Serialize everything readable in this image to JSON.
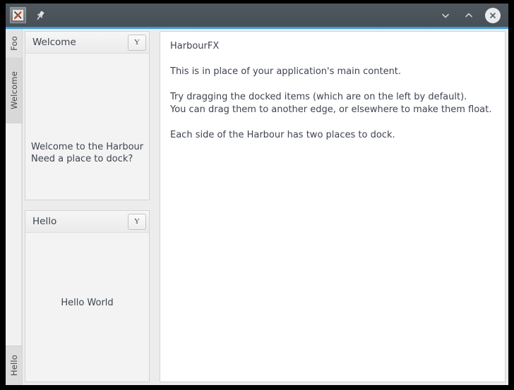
{
  "window": {
    "titlebar": {
      "app_icon": "application-x-icon",
      "pin_icon": "pin-icon",
      "minimize_label": "⌄",
      "maximize_label": "⌃",
      "close_label": "✕",
      "bar_color": "#4a525a",
      "accent_color": "#3a9cd9"
    }
  },
  "tabstrip": {
    "items": [
      {
        "label": "Foo",
        "active": false
      },
      {
        "label": "Welcome",
        "active": true
      },
      {
        "label": "Hello",
        "active": true
      }
    ]
  },
  "dock_panels": [
    {
      "title": "Welcome",
      "button_label": "Y",
      "button_icon": "chevron-down-icon",
      "content_lines": [
        "Welcome to the Harbour",
        "Need a place to dock?"
      ]
    },
    {
      "title": "Hello",
      "button_label": "Y",
      "button_icon": "chevron-down-icon",
      "content_lines": [
        "Hello World"
      ]
    }
  ],
  "main": {
    "heading": "HarbourFX",
    "paragraph1": "This is in place of your application's main content.",
    "paragraph2_line1": "Try dragging the docked items (which are on the left by default).",
    "paragraph2_line2": "You can drag them to another edge, or elsewhere to make them float.",
    "paragraph3": "Each side of the Harbour has two places to dock."
  }
}
